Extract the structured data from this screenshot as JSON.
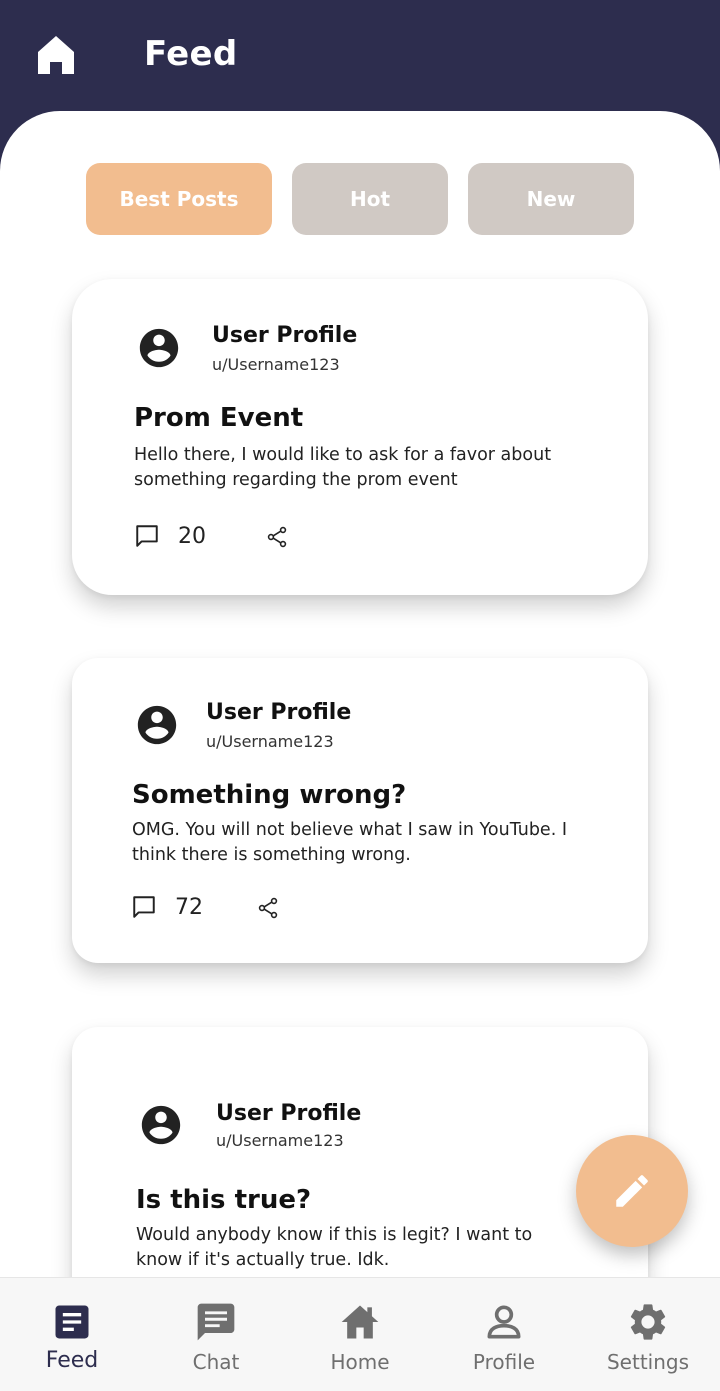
{
  "header": {
    "title": "Feed",
    "home_icon": "home-icon"
  },
  "tabs": [
    {
      "label": "Best Posts",
      "active": true,
      "color": "#f2bd8f"
    },
    {
      "label": "Hot",
      "active": false,
      "color": "#d0c9c4"
    },
    {
      "label": "New",
      "active": false,
      "color": "#d0c9c4"
    }
  ],
  "posts": [
    {
      "user_name": "User Profile",
      "username": "u/Username123",
      "title": "Prom Event",
      "body": "Hello there, I would like to ask for a favor about something regarding the prom event",
      "comments": "20"
    },
    {
      "user_name": "User Profile",
      "username": "u/Username123",
      "title": "Something wrong?",
      "body": "OMG. You will not believe what I saw in YouTube. I think there is something wrong.",
      "comments": "72"
    },
    {
      "user_name": "User Profile",
      "username": "u/Username123",
      "title": "Is this true?",
      "body": "Would anybody know if this is legit? I want to know if it's actually true. Idk."
    }
  ],
  "fab": {
    "icon": "pencil-icon"
  },
  "bottom_nav": [
    {
      "label": "Feed",
      "icon": "feed-icon",
      "active": true
    },
    {
      "label": "Chat",
      "icon": "chat-icon",
      "active": false
    },
    {
      "label": "Home",
      "icon": "home-icon",
      "active": false
    },
    {
      "label": "Profile",
      "icon": "profile-icon",
      "active": false
    },
    {
      "label": "Settings",
      "icon": "gear-icon",
      "active": false
    }
  ],
  "colors": {
    "header_bg": "#2d2d4e",
    "accent": "#f2bd8f",
    "inactive_tab": "#d0c9c4"
  }
}
